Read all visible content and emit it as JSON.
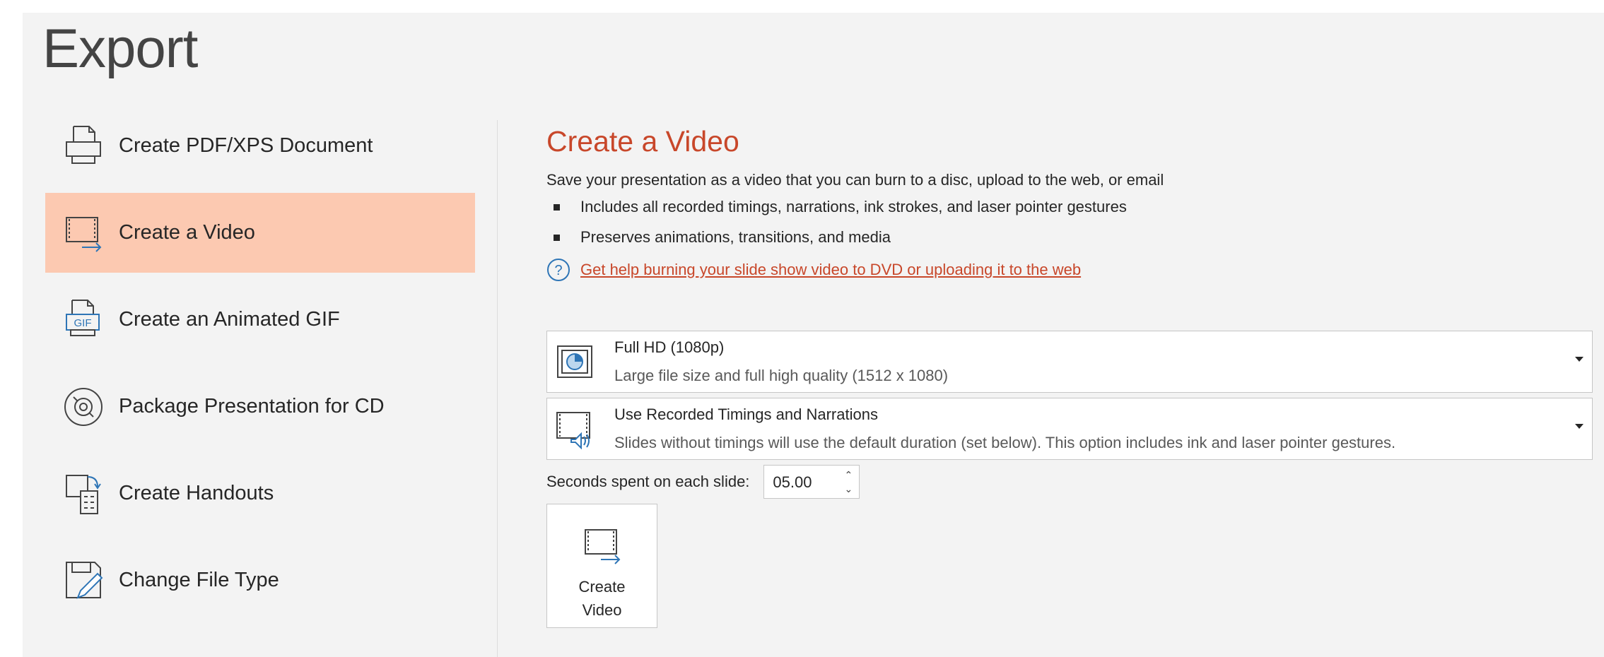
{
  "page": {
    "title": "Export"
  },
  "nav": {
    "items": [
      {
        "label": "Create PDF/XPS Document",
        "icon": "pdf-document-icon"
      },
      {
        "label": "Create a Video",
        "icon": "video-icon",
        "selected": true
      },
      {
        "label": "Create an Animated GIF",
        "icon": "gif-icon"
      },
      {
        "label": "Package Presentation for CD",
        "icon": "cd-icon"
      },
      {
        "label": "Create Handouts",
        "icon": "handouts-icon"
      },
      {
        "label": "Change File Type",
        "icon": "change-file-type-icon"
      }
    ]
  },
  "content": {
    "title": "Create a Video",
    "description": "Save your presentation as a video that you can burn to a disc, upload to the web, or email",
    "bullets": [
      "Includes all recorded timings, narrations, ink strokes, and laser pointer gestures",
      "Preserves animations, transitions, and media"
    ],
    "help_link": "Get help burning your slide show video to DVD or uploading it to the web",
    "quality": {
      "value": "Full HD (1080p)",
      "detail": "Large file size and full high quality (1512 x 1080)"
    },
    "timings": {
      "value": "Use Recorded Timings and Narrations",
      "detail": "Slides without timings will use the default duration (set below). This option includes ink and laser pointer gestures."
    },
    "seconds": {
      "label": "Seconds spent on each slide:",
      "value": "05.00"
    },
    "create_button": "Create\nVideo"
  },
  "colors": {
    "accent": "#c8472a",
    "selected_bg": "#fcc9b1",
    "panel_bg": "#f3f3f3",
    "icon_blue": "#2e75b6"
  }
}
